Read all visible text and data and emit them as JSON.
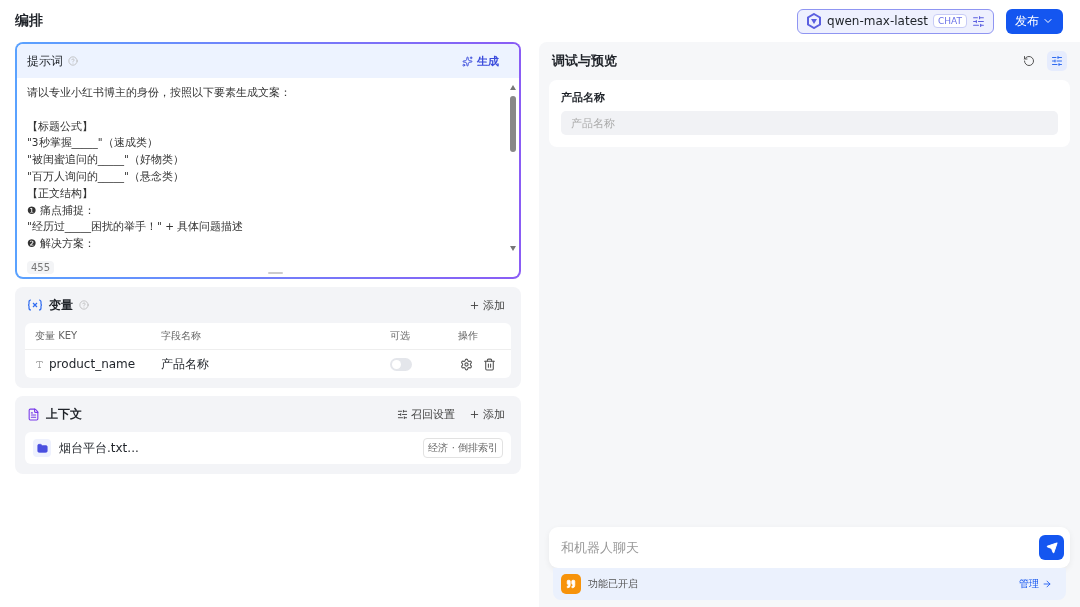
{
  "page_title": "编排",
  "model": {
    "name": "qwen-max-latest",
    "badge": "CHAT"
  },
  "publish_button": "发布",
  "prompt": {
    "title": "提示词",
    "generate": "生成",
    "intro": "请以专业小红书博主的身份，按照以下要素生成文案：",
    "lines": [
      "【标题公式】",
      "\"3秒掌握_____\"（速成类）",
      "\"被闺蜜追问的_____\"（好物类）",
      "\"百万人询问的_____\"（悬念类）",
      "【正文结构】",
      "❶ 痛点捕捉：",
      "\"经历过_____困扰的举手！\" + 具体问题描述",
      "❷ 解决方案："
    ],
    "count": "455"
  },
  "variables": {
    "title": "变量",
    "add": "添加",
    "columns": [
      "变量 KEY",
      "字段名称",
      "可选",
      "操作"
    ],
    "rows": [
      {
        "key": "product_name",
        "name": "产品名称",
        "optional": false
      }
    ]
  },
  "context": {
    "title": "上下文",
    "recall": "召回设置",
    "add": "添加",
    "files": [
      {
        "name": "烟台平台.txt...",
        "tag": "经济 · 倒排索引"
      }
    ]
  },
  "preview": {
    "title": "调试与预览",
    "field_label": "产品名称",
    "field_placeholder": "产品名称",
    "chat_placeholder": "和机器人聊天",
    "feature_status": "功能已开启",
    "manage": "管理"
  }
}
